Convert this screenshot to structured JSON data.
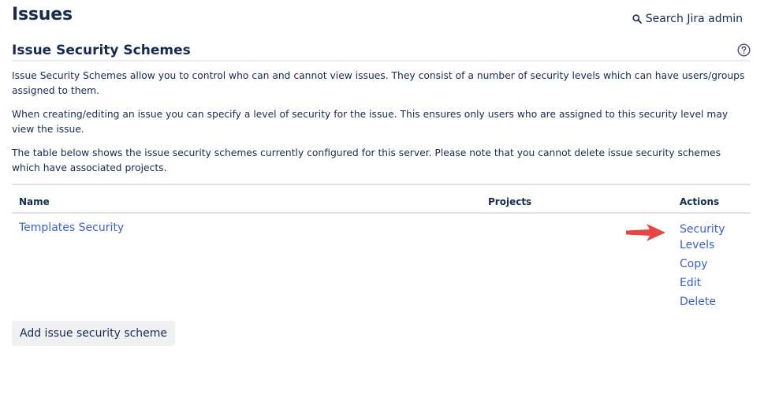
{
  "header": {
    "title": "Issues",
    "search_label": "Search Jira admin",
    "search_icon": "search-icon"
  },
  "section": {
    "title": "Issue Security Schemes",
    "help_icon": "help-icon",
    "paragraphs": [
      "Issue Security Schemes allow you to control who can and cannot view issues. They consist of a number of security levels which can have users/groups assigned to them.",
      "When creating/editing an issue you can specify a level of security for the issue. This ensures only users who are assigned to this security level may view the issue.",
      "The table below shows the issue security schemes currently configured for this server. Please note that you cannot delete issue security schemes which have associated projects."
    ]
  },
  "table": {
    "columns": [
      "Name",
      "Projects",
      "Actions"
    ],
    "rows": [
      {
        "name": "Templates Security",
        "projects": "",
        "actions": [
          "Security Levels",
          "Copy",
          "Edit",
          "Delete"
        ]
      }
    ]
  },
  "annotation": {
    "arrow_color": "#e84545",
    "points_to": "Security Levels"
  },
  "colors": {
    "link": "#3b5fd1",
    "text": "#172b4d",
    "button_bg": "#f0f1f4"
  },
  "add_button_label": "Add issue security scheme"
}
